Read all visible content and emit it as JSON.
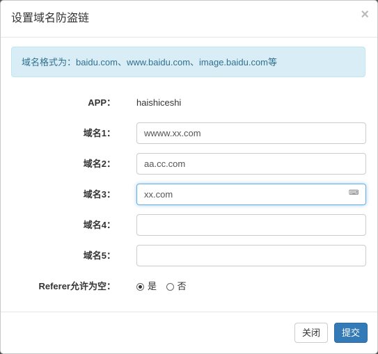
{
  "modal": {
    "title": "设置域名防盗链",
    "close_label": "×"
  },
  "alert": {
    "text": "域名格式为：baidu.com、www.baidu.com、image.baidu.com等"
  },
  "form": {
    "app_label": "APP：",
    "app_value": "haishiceshi",
    "domains": [
      {
        "label": "域名1：",
        "value": "wwww.xx.com"
      },
      {
        "label": "域名2：",
        "value": "aa.cc.com"
      },
      {
        "label": "域名3：",
        "value": "xx.com"
      },
      {
        "label": "域名4：",
        "value": ""
      },
      {
        "label": "域名5：",
        "value": ""
      }
    ],
    "referer_label": "Referer允许为空：",
    "referer_options": [
      {
        "label": "是",
        "checked": true
      },
      {
        "label": "否",
        "checked": false
      }
    ]
  },
  "input_icon": {
    "glyph": "⌨",
    "name": "keyboard-icon"
  },
  "footer": {
    "close_button": "关闭",
    "submit_button": "提交"
  },
  "colors": {
    "primary": "#337ab7",
    "alert_bg": "#d9edf7",
    "alert_text": "#31708f",
    "focus_border": "#66afe9"
  }
}
